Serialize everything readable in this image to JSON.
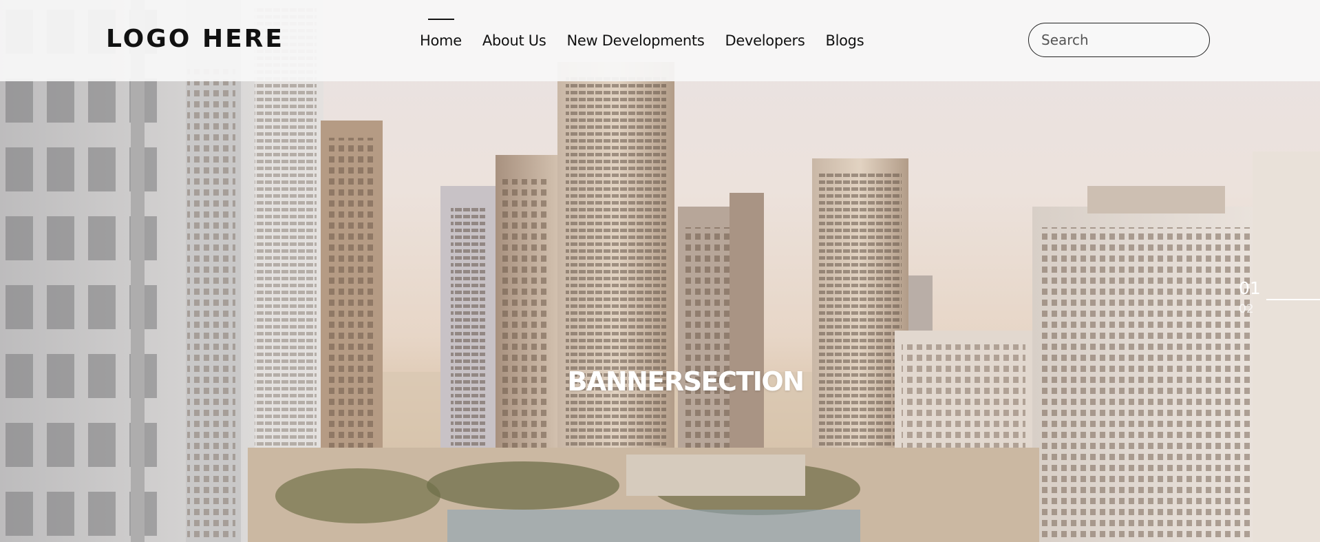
{
  "header": {
    "logo": "LOGO HERE",
    "nav": [
      {
        "label": "Home",
        "active": true
      },
      {
        "label": "About Us",
        "active": false
      },
      {
        "label": "New Developments",
        "active": false
      },
      {
        "label": "Developers",
        "active": false
      },
      {
        "label": "Blogs",
        "active": false
      }
    ],
    "search": {
      "placeholder": "Search",
      "value": "",
      "icon": "search-icon"
    }
  },
  "banner": {
    "title": "BANNERSECTION",
    "background": "city-skyline-photo"
  },
  "slider": {
    "current": "01",
    "next": "02"
  },
  "colors": {
    "header_bg": "#f8f8f8",
    "text": "#111111",
    "banner_text": "#ffffff"
  }
}
